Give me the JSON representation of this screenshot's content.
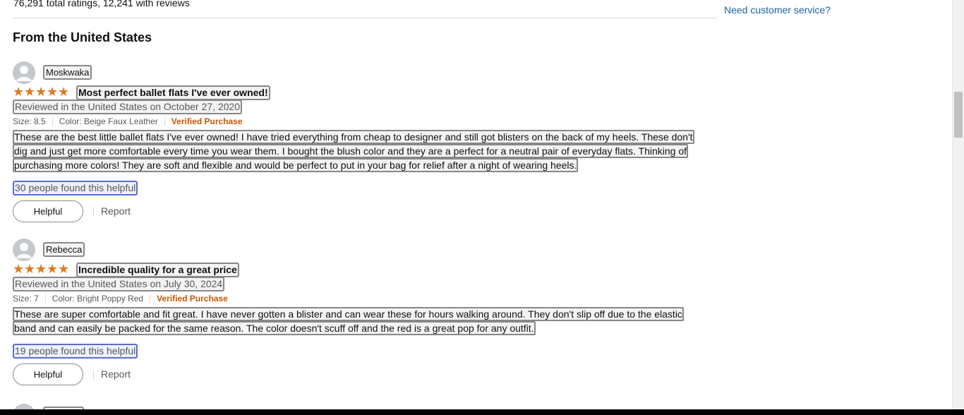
{
  "summary": {
    "ratings_text": "76,291 total ratings, 12,241 with reviews"
  },
  "sidebar": {
    "customer_service": "Need customer service?"
  },
  "section_title": "From the United States",
  "reviews": [
    {
      "reviewer": "Moskwaka",
      "rating": 5,
      "title": "Most perfect ballet flats I've ever owned!",
      "date": "Reviewed in the United States on October 27, 2020",
      "size": "Size: 8.5",
      "color": "Color: Beige Faux Leather",
      "verified": "Verified Purchase",
      "body_lines": [
        "These are the best little ballet flats I've ever owned! I have tried everything from cheap to designer and still got blisters on the back of my heels. These don't",
        "dig and just get more comfortable every time you wear them. I bought the blush color and they are a perfect for a neutral pair of everyday flats. Thinking of",
        "purchasing more colors! They are soft and flexible and would be perfect to put in your bag for relief after a night of wearing heels."
      ],
      "helpful_count": "30 people found this helpful",
      "helpful_button": "Helpful",
      "report": "Report"
    },
    {
      "reviewer": "Rebecca",
      "rating": 5,
      "title": "Incredible quality for a great price",
      "date": "Reviewed in the United States on July 30, 2024",
      "size": "Size: 7",
      "color": "Color: Bright Poppy Red",
      "verified": "Verified Purchase",
      "body_lines": [
        "These are super comfortable and fit great. I have never gotten a blister and can wear these for hours walking around. They don't slip off due to the elastic",
        "band and can easily be packed for the same reason. The color doesn't scuff off and the red is a great pop for any outfit."
      ],
      "helpful_count": "19 people found this helpful",
      "helpful_button": "Helpful",
      "report": "Report"
    }
  ],
  "colors": {
    "star": "#de7921",
    "verified": "#c45500",
    "link": "#2162a1"
  },
  "icons": {
    "avatar": "user-silhouette-icon",
    "star": "star-filled-icon"
  }
}
